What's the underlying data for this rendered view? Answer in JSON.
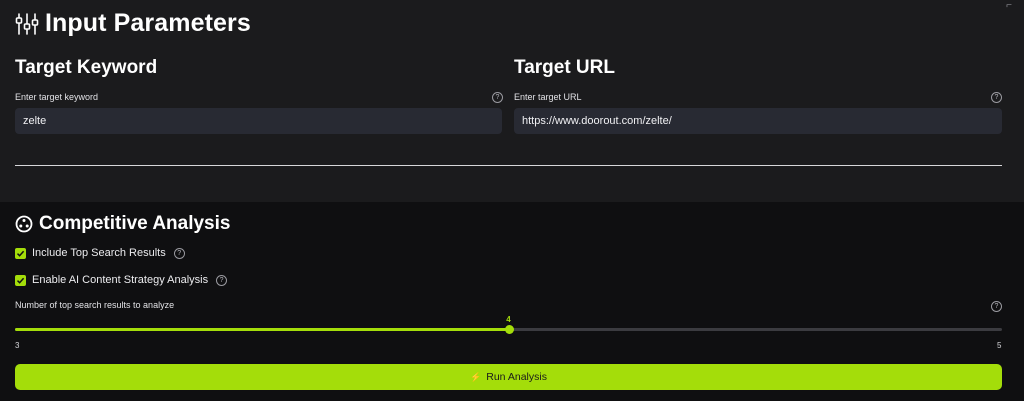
{
  "header": {
    "title": "Input Parameters",
    "icon": "sliders-icon"
  },
  "keyword": {
    "title": "Target Keyword",
    "label": "Enter target keyword",
    "value": "zelte"
  },
  "url": {
    "title": "Target URL",
    "label": "Enter target URL",
    "value": "https://www.doorout.com/zelte/"
  },
  "competitive": {
    "title": "Competitive Analysis",
    "icon": "cog-icon",
    "options": [
      {
        "label": "Include Top Search Results",
        "checked": true
      },
      {
        "label": "Enable AI Content Strategy Analysis",
        "checked": true
      }
    ]
  },
  "slider": {
    "label": "Number of top search results to analyze",
    "min": 3,
    "max": 5,
    "value": 4,
    "min_label": "3",
    "max_label": "5",
    "value_label": "4"
  },
  "run_button": {
    "label": "Run Analysis",
    "icon": "bolt-icon"
  },
  "colors": {
    "accent": "#a4dd0a",
    "panel": "#1b1b1d",
    "background": "#0f0f11",
    "input": "#282a33"
  }
}
